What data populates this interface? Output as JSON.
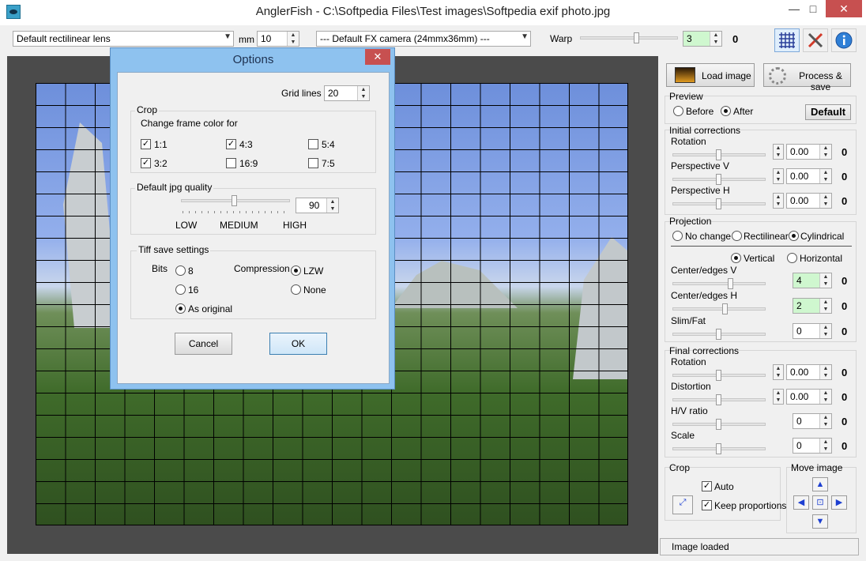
{
  "window": {
    "title": "AnglerFish - C:\\Softpedia Files\\Test images\\Softpedia exif photo.jpg",
    "minimize_glyph": "—",
    "maximize_glyph": "□",
    "close_glyph": "✕"
  },
  "toolbar": {
    "lens": "Default rectilinear lens",
    "mm_label": "mm",
    "mm_value": "10",
    "camera": "--- Default FX camera (24mmx36mm) ---",
    "warp_label": "Warp",
    "warp_value": "3",
    "warp_readout": "0",
    "icons": [
      "grid-icon",
      "tools-icon",
      "info-icon"
    ]
  },
  "panel": {
    "load_image": "Load image",
    "process_save": "Process & save",
    "preview": {
      "legend": "Preview",
      "before": "Before",
      "after": "After",
      "selected": "after",
      "default_button": "Default"
    },
    "initial": {
      "legend": "Initial corrections",
      "rows": [
        {
          "label": "Rotation",
          "value": "0.00",
          "readout": "0"
        },
        {
          "label": "Perspective V",
          "value": "0.00",
          "readout": "0"
        },
        {
          "label": "Perspective H",
          "value": "0.00",
          "readout": "0"
        }
      ]
    },
    "projection": {
      "legend": "Projection",
      "no_change": "No change",
      "rectilinear": "Rectilinear",
      "cylindrical": "Cylindrical",
      "vertical": "Vertical",
      "horizontal": "Horizontal",
      "selected_projection": "cylindrical",
      "selected_orientation": "vertical",
      "rows": [
        {
          "label": "Center/edges V",
          "value": "4",
          "readout": "0"
        },
        {
          "label": "Center/edges H",
          "value": "2",
          "readout": "0"
        },
        {
          "label": "Slim/Fat",
          "value": "0",
          "readout": "0"
        }
      ]
    },
    "final": {
      "legend": "Final corrections",
      "rows": [
        {
          "label": "Rotation",
          "value": "0.00",
          "readout": "0"
        },
        {
          "label": "Distortion",
          "value": "0.00",
          "readout": "0"
        },
        {
          "label": "H/V ratio",
          "value": "0",
          "readout": "0"
        },
        {
          "label": "Scale",
          "value": "0",
          "readout": "0"
        }
      ]
    },
    "crop": {
      "legend": "Crop",
      "auto": "Auto",
      "keep_proportions": "Keep proportions",
      "auto_checked": true,
      "keep_checked": true
    },
    "move": {
      "legend": "Move image"
    },
    "status": "Image loaded"
  },
  "dialog": {
    "title": "Options",
    "grid_lines_label": "Grid lines",
    "grid_lines_value": "20",
    "crop": {
      "legend": "Crop",
      "subtitle": "Change frame color for",
      "ratios": [
        {
          "label": "1:1",
          "checked": true
        },
        {
          "label": "4:3",
          "checked": true
        },
        {
          "label": "5:4",
          "checked": false
        },
        {
          "label": "3:2",
          "checked": true
        },
        {
          "label": "16:9",
          "checked": false
        },
        {
          "label": "7:5",
          "checked": false
        }
      ]
    },
    "jpg": {
      "legend": "Default jpg quality",
      "value": "90",
      "low": "LOW",
      "medium": "MEDIUM",
      "high": "HIGH"
    },
    "tiff": {
      "legend": "Tiff save settings",
      "bits_label": "Bits",
      "bits_8": "8",
      "bits_16": "16",
      "bits_original": "As original",
      "bits_selected": "original",
      "compression_label": "Compression",
      "lzw": "LZW",
      "none": "None",
      "compression_selected": "lzw"
    },
    "cancel": "Cancel",
    "ok": "OK"
  }
}
